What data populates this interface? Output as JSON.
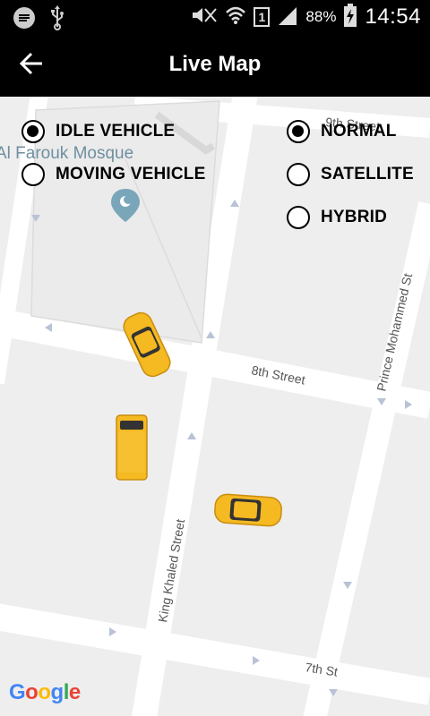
{
  "status_bar": {
    "battery": "88%",
    "time": "14:54",
    "sim_slot": "1"
  },
  "action_bar": {
    "title": "Live Map",
    "back_icon": "arrow-left-icon"
  },
  "map": {
    "street_labels": {
      "ninth": "9th Street",
      "eighth": "8th Street",
      "seventh": "7th St",
      "prince": "Prince Mohammed St",
      "king": "King Khaled Street"
    },
    "poi_label": "Al Farouk Mosque",
    "google": {
      "letters": [
        "G",
        "o",
        "o",
        "g",
        "l",
        "e"
      ],
      "colors": [
        "#4285F4",
        "#EA4335",
        "#FBBC05",
        "#4285F4",
        "#34A853",
        "#EA4335"
      ]
    }
  },
  "vehicle_filter": {
    "options": [
      {
        "label": "IDLE VEHICLE",
        "checked": true
      },
      {
        "label": "MOVING VEHICLE",
        "checked": false
      }
    ]
  },
  "map_type": {
    "options": [
      {
        "label": "NORMAL",
        "checked": true
      },
      {
        "label": "SATELLITE",
        "checked": false
      },
      {
        "label": "HYBRID",
        "checked": false
      }
    ]
  },
  "colors": {
    "taxi": "#f5b921",
    "road": "#ffffff",
    "block": "#eeeeee"
  }
}
